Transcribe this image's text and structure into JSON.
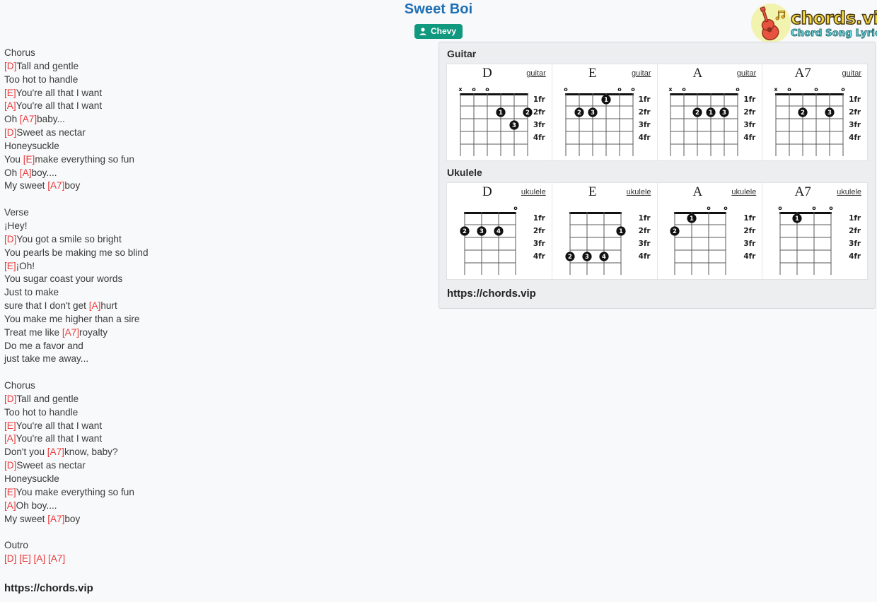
{
  "header": {
    "song_title": "Sweet Boi",
    "artist_badge": {
      "label": "Chevy",
      "icon": "user-icon",
      "color": "#119980"
    },
    "logo": {
      "main": "chords.vip",
      "sub": "Chord Song Lyric"
    }
  },
  "lyrics": {
    "lines": [
      [
        {
          "t": "Chorus",
          "c": false
        }
      ],
      [
        {
          "t": "[D]",
          "c": true
        },
        {
          "t": "Tall and gentle",
          "c": false
        }
      ],
      [
        {
          "t": "Too hot to handle",
          "c": false
        }
      ],
      [
        {
          "t": "[E]",
          "c": true
        },
        {
          "t": "You're all that I want",
          "c": false
        }
      ],
      [
        {
          "t": "[A]",
          "c": true
        },
        {
          "t": "You're all that I want",
          "c": false
        }
      ],
      [
        {
          "t": "Oh ",
          "c": false
        },
        {
          "t": "[A7]",
          "c": true
        },
        {
          "t": "baby...",
          "c": false
        }
      ],
      [
        {
          "t": "[D]",
          "c": true
        },
        {
          "t": "Sweet as nectar",
          "c": false
        }
      ],
      [
        {
          "t": "Honeysuckle",
          "c": false
        }
      ],
      [
        {
          "t": "You ",
          "c": false
        },
        {
          "t": "[E]",
          "c": true
        },
        {
          "t": "make everything so fun",
          "c": false
        }
      ],
      [
        {
          "t": "Oh ",
          "c": false
        },
        {
          "t": "[A]",
          "c": true
        },
        {
          "t": "boy....",
          "c": false
        }
      ],
      [
        {
          "t": "My sweet ",
          "c": false
        },
        {
          "t": "[A7]",
          "c": true
        },
        {
          "t": "boy",
          "c": false
        }
      ],
      [
        {
          "t": "",
          "c": false
        }
      ],
      [
        {
          "t": "Verse",
          "c": false
        }
      ],
      [
        {
          "t": "¡Hey!",
          "c": false
        }
      ],
      [
        {
          "t": "[D]",
          "c": true
        },
        {
          "t": "You got a smile so bright",
          "c": false
        }
      ],
      [
        {
          "t": "You pearls be making me so blind",
          "c": false
        }
      ],
      [
        {
          "t": "[E]",
          "c": true
        },
        {
          "t": "¡Oh!",
          "c": false
        }
      ],
      [
        {
          "t": "You sugar coast your words",
          "c": false
        }
      ],
      [
        {
          "t": "Just to make",
          "c": false
        }
      ],
      [
        {
          "t": "sure that I don't get ",
          "c": false
        },
        {
          "t": "[A]",
          "c": true
        },
        {
          "t": "hurt",
          "c": false
        }
      ],
      [
        {
          "t": "You make me higher than a sire",
          "c": false
        }
      ],
      [
        {
          "t": "Treat me like ",
          "c": false
        },
        {
          "t": "[A7]",
          "c": true
        },
        {
          "t": "royalty",
          "c": false
        }
      ],
      [
        {
          "t": "Do me a favor and",
          "c": false
        }
      ],
      [
        {
          "t": "just take me away...",
          "c": false
        }
      ],
      [
        {
          "t": "",
          "c": false
        }
      ],
      [
        {
          "t": "Chorus",
          "c": false
        }
      ],
      [
        {
          "t": "[D]",
          "c": true
        },
        {
          "t": "Tall and gentle",
          "c": false
        }
      ],
      [
        {
          "t": "Too hot to handle",
          "c": false
        }
      ],
      [
        {
          "t": "[E]",
          "c": true
        },
        {
          "t": "You're all that I want",
          "c": false
        }
      ],
      [
        {
          "t": "[A]",
          "c": true
        },
        {
          "t": "You're all that I want",
          "c": false
        }
      ],
      [
        {
          "t": "Don't you ",
          "c": false
        },
        {
          "t": "[A7]",
          "c": true
        },
        {
          "t": "know, baby?",
          "c": false
        }
      ],
      [
        {
          "t": "[D]",
          "c": true
        },
        {
          "t": "Sweet as nectar",
          "c": false
        }
      ],
      [
        {
          "t": "Honeysuckle",
          "c": false
        }
      ],
      [
        {
          "t": "[E]",
          "c": true
        },
        {
          "t": "You make everything so fun",
          "c": false
        }
      ],
      [
        {
          "t": "[A]",
          "c": true
        },
        {
          "t": "Oh boy....",
          "c": false
        }
      ],
      [
        {
          "t": "My sweet ",
          "c": false
        },
        {
          "t": "[A7]",
          "c": true
        },
        {
          "t": "boy",
          "c": false
        }
      ],
      [
        {
          "t": "",
          "c": false
        }
      ],
      [
        {
          "t": "Outro",
          "c": false
        }
      ],
      [
        {
          "t": "[D] [E] [A] [A7]",
          "c": true
        }
      ]
    ],
    "footer_url": "https://chords.vip"
  },
  "chord_panel": {
    "url": "https://chords.vip",
    "sections": [
      {
        "title": "Guitar",
        "tag": "guitar",
        "strings": 6,
        "frets": 4,
        "fret_labels": [
          "1fr",
          "2fr",
          "3fr",
          "4fr"
        ],
        "chords": [
          {
            "name": "D",
            "open_markers": [
              "x",
              "o",
              "o",
              "",
              "",
              ""
            ],
            "dots": [
              {
                "string": 4,
                "fret": 2,
                "finger": "1"
              },
              {
                "string": 6,
                "fret": 2,
                "finger": "2"
              },
              {
                "string": 5,
                "fret": 3,
                "finger": "3"
              }
            ]
          },
          {
            "name": "E",
            "open_markers": [
              "o",
              "",
              "",
              "",
              "o",
              "o"
            ],
            "dots": [
              {
                "string": 4,
                "fret": 1,
                "finger": "1"
              },
              {
                "string": 2,
                "fret": 2,
                "finger": "2"
              },
              {
                "string": 3,
                "fret": 2,
                "finger": "3"
              }
            ]
          },
          {
            "name": "A",
            "open_markers": [
              "x",
              "o",
              "",
              "",
              "",
              "o"
            ],
            "dots": [
              {
                "string": 3,
                "fret": 2,
                "finger": "2"
              },
              {
                "string": 4,
                "fret": 2,
                "finger": "1"
              },
              {
                "string": 5,
                "fret": 2,
                "finger": "3"
              }
            ]
          },
          {
            "name": "A7",
            "open_markers": [
              "x",
              "o",
              "",
              "o",
              "",
              "o"
            ],
            "dots": [
              {
                "string": 3,
                "fret": 2,
                "finger": "2"
              },
              {
                "string": 5,
                "fret": 2,
                "finger": "3"
              }
            ]
          }
        ]
      },
      {
        "title": "Ukulele",
        "tag": "ukulele",
        "strings": 4,
        "frets": 4,
        "fret_labels": [
          "1fr",
          "2fr",
          "3fr",
          "4fr"
        ],
        "chords": [
          {
            "name": "D",
            "open_markers": [
              "",
              "",
              "",
              "o"
            ],
            "dots": [
              {
                "string": 1,
                "fret": 2,
                "finger": "2"
              },
              {
                "string": 2,
                "fret": 2,
                "finger": "3"
              },
              {
                "string": 3,
                "fret": 2,
                "finger": "4"
              }
            ]
          },
          {
            "name": "E",
            "open_markers": [
              "",
              "",
              "",
              ""
            ],
            "dots": [
              {
                "string": 4,
                "fret": 2,
                "finger": "1"
              },
              {
                "string": 1,
                "fret": 4,
                "finger": "2"
              },
              {
                "string": 2,
                "fret": 4,
                "finger": "3"
              },
              {
                "string": 3,
                "fret": 4,
                "finger": "4"
              }
            ]
          },
          {
            "name": "A",
            "open_markers": [
              "",
              "",
              "o",
              "o"
            ],
            "dots": [
              {
                "string": 2,
                "fret": 1,
                "finger": "1"
              },
              {
                "string": 1,
                "fret": 2,
                "finger": "2"
              }
            ]
          },
          {
            "name": "A7",
            "open_markers": [
              "o",
              "",
              "o",
              "o"
            ],
            "dots": [
              {
                "string": 2,
                "fret": 1,
                "finger": "1"
              }
            ]
          }
        ]
      }
    ]
  }
}
